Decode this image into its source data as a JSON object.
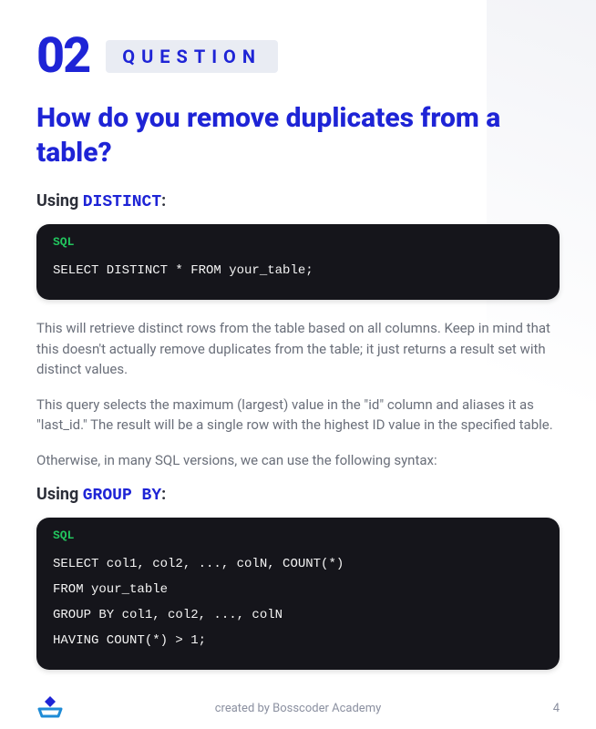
{
  "header": {
    "number": "02",
    "label": "QUESTION"
  },
  "title": "How do you remove duplicates from a table?",
  "section1": {
    "subhead_prefix": "Using ",
    "subhead_keyword": "DISTINCT",
    "subhead_suffix": ":",
    "code_lang": "SQL",
    "code": "SELECT DISTINCT * FROM your_table;"
  },
  "para1": "This will retrieve distinct rows from the table based on all columns. Keep in mind that this doesn't actually remove duplicates from the table; it just returns a result set with distinct values.",
  "para2": "This query selects the maximum (largest) value in the \"id\" column and aliases it as \"last_id.\" The result will be a single row with the highest ID value in the specified table.",
  "para3": "Otherwise, in many SQL versions, we can use the following syntax:",
  "section2": {
    "subhead_prefix": "Using ",
    "subhead_keyword": "GROUP BY",
    "subhead_suffix": ":",
    "code_lang": "SQL",
    "code": "SELECT col1, col2, ..., colN, COUNT(*)\nFROM your_table\nGROUP BY col1, col2, ..., colN\nHAVING COUNT(*) > 1;"
  },
  "footer": {
    "credit": "created by Bosscoder Academy",
    "page_number": "4"
  }
}
